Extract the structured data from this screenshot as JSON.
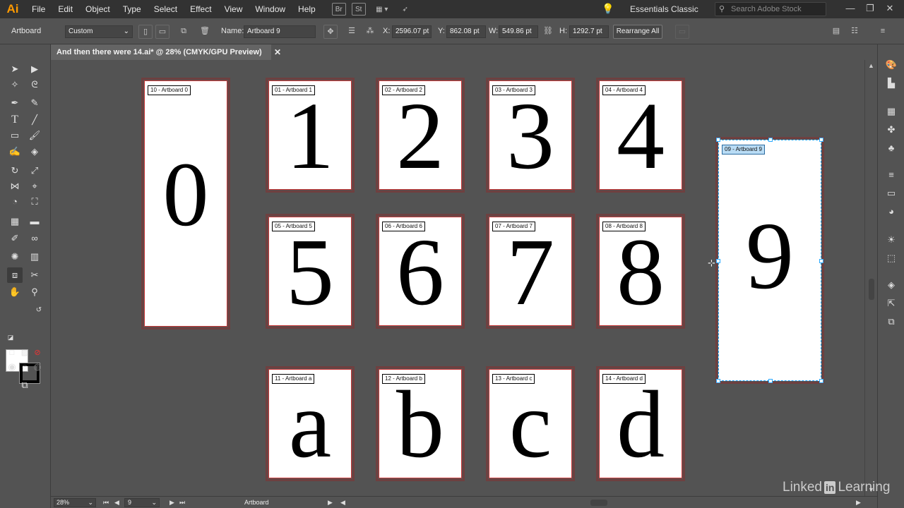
{
  "app": {
    "logo": "Ai"
  },
  "menu": [
    "File",
    "Edit",
    "Object",
    "Type",
    "Select",
    "Effect",
    "View",
    "Window",
    "Help"
  ],
  "menubar_icons": {
    "bridge": "Br",
    "stock": "St"
  },
  "workspace": "Essentials Classic",
  "search": {
    "placeholder": "Search Adobe Stock"
  },
  "control_bar": {
    "tool_label": "Artboard",
    "preset": "Custom",
    "name_label": "Name:",
    "name_value": "Artboard 9",
    "x_label": "X:",
    "x_value": "2596.07 pt",
    "y_label": "Y:",
    "y_value": "862.08 pt",
    "w_label": "W:",
    "w_value": "549.86 pt",
    "h_label": "H:",
    "h_value": "1292.7 pt",
    "rearrange": "Rearrange All"
  },
  "document_tab": "And then there were 14.ai* @ 28% (CMYK/GPU Preview)",
  "artboards": [
    {
      "label": "10 - Artboard 0",
      "glyph": "0"
    },
    {
      "label": "01 - Artboard 1",
      "glyph": "1"
    },
    {
      "label": "02 - Artboard 2",
      "glyph": "2"
    },
    {
      "label": "03 - Artboard 3",
      "glyph": "3"
    },
    {
      "label": "04 - Artboard 4",
      "glyph": "4"
    },
    {
      "label": "05 - Artboard 5",
      "glyph": "5"
    },
    {
      "label": "06 - Artboard 6",
      "glyph": "6"
    },
    {
      "label": "07 - Artboard 7",
      "glyph": "7"
    },
    {
      "label": "08 - Artboard 8",
      "glyph": "8"
    },
    {
      "label": "09 - Artboard 9",
      "glyph": "9",
      "selected": true
    },
    {
      "label": "11 - Artboard a",
      "glyph": "a"
    },
    {
      "label": "12 - Artboard b",
      "glyph": "b"
    },
    {
      "label": "13 - Artboard c",
      "glyph": "c"
    },
    {
      "label": "14 - Artboard d",
      "glyph": "d"
    }
  ],
  "status_bar": {
    "zoom": "28%",
    "artboard_number": "9",
    "tool": "Artboard"
  },
  "watermark": {
    "left": "Linked",
    "badge": "in",
    "right": "Learning"
  },
  "colors": {
    "accent": "#29a9ff",
    "artboard_border": "#cc3333",
    "ui_bg": "#535353",
    "logo": "#ff9a00"
  }
}
